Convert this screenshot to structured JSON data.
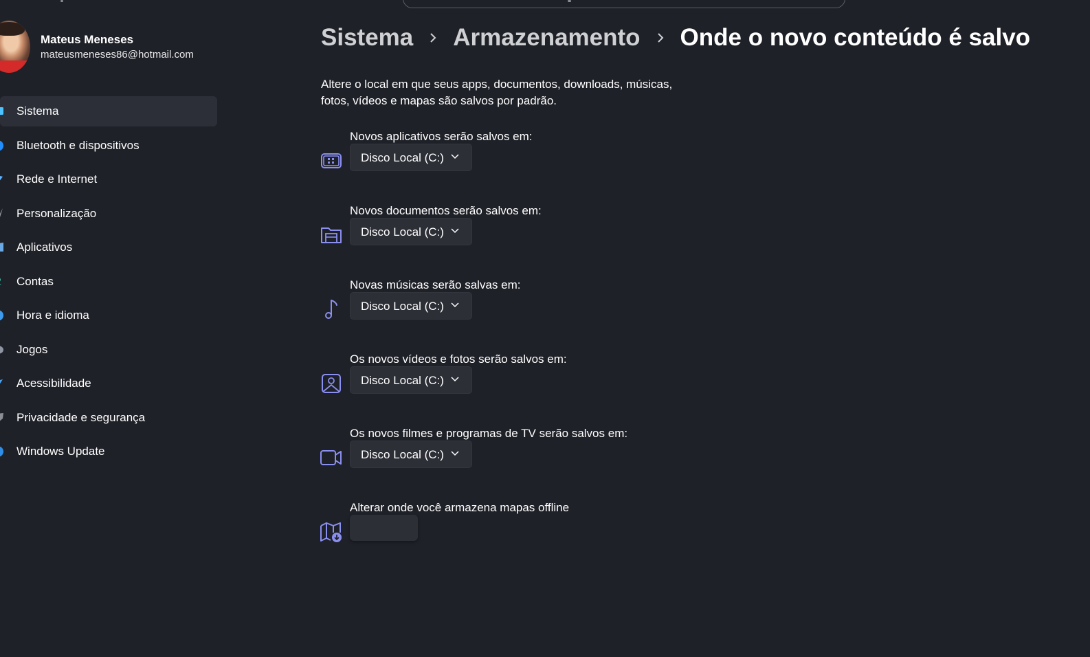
{
  "user": {
    "name": "Mateus Meneses",
    "email": "mateusmeneses86@hotmail.com"
  },
  "sidebar": {
    "items": [
      {
        "label": "Sistema",
        "icon": "monitor-icon",
        "color": "#4cc2ff",
        "active": true
      },
      {
        "label": "Bluetooth e dispositivos",
        "icon": "bluetooth-icon",
        "color": "#1f8fff"
      },
      {
        "label": "Rede e Internet",
        "icon": "wifi-icon",
        "color": "#5fb2ff"
      },
      {
        "label": "Personalização",
        "icon": "brush-icon",
        "color": "#9a9ca2"
      },
      {
        "label": "Aplicativos",
        "icon": "apps-icon",
        "color": "#6aa8e6"
      },
      {
        "label": "Contas",
        "icon": "person-icon",
        "color": "#39c2a8"
      },
      {
        "label": "Hora e idioma",
        "icon": "globe-icon",
        "color": "#3b9cf0"
      },
      {
        "label": "Jogos",
        "icon": "controller-icon",
        "color": "#8f95a3"
      },
      {
        "label": "Acessibilidade",
        "icon": "accessibility-icon",
        "color": "#4aa3f0"
      },
      {
        "label": "Privacidade e segurança",
        "icon": "shield-icon",
        "color": "#8c8e96"
      },
      {
        "label": "Windows Update",
        "icon": "update-icon",
        "color": "#2f8fe8"
      }
    ]
  },
  "header": {
    "breadcrumb": [
      "Sistema",
      "Armazenamento",
      "Onde o novo conteúdo é salvo"
    ]
  },
  "main": {
    "description_line1": "Altere o local em que seus apps, documentos, downloads, músicas,",
    "description_line2": "fotos, vídeos e mapas são salvos por padrão.",
    "settings": [
      {
        "label": "Novos aplicativos serão salvos em:",
        "value": "Disco Local (C:)",
        "icon": "apps-window-icon"
      },
      {
        "label": "Novos documentos serão salvos em:",
        "value": "Disco Local (C:)",
        "icon": "document-folder-icon"
      },
      {
        "label": "Novas músicas serão salvas em:",
        "value": "Disco Local (C:)",
        "icon": "music-note-icon"
      },
      {
        "label": "Os novos vídeos e fotos serão salvos em:",
        "value": "Disco Local (C:)",
        "icon": "photo-icon"
      },
      {
        "label": "Os novos filmes e programas de TV serão salvos em:",
        "value": "Disco Local (C:)",
        "icon": "video-camera-icon"
      },
      {
        "label": "Alterar onde você armazena mapas offline",
        "value": "",
        "icon": "map-download-icon"
      }
    ]
  },
  "colors": {
    "background": "#1f2128",
    "accent_icon": "#8b8ff0",
    "control_bg": "#2d2f37"
  }
}
